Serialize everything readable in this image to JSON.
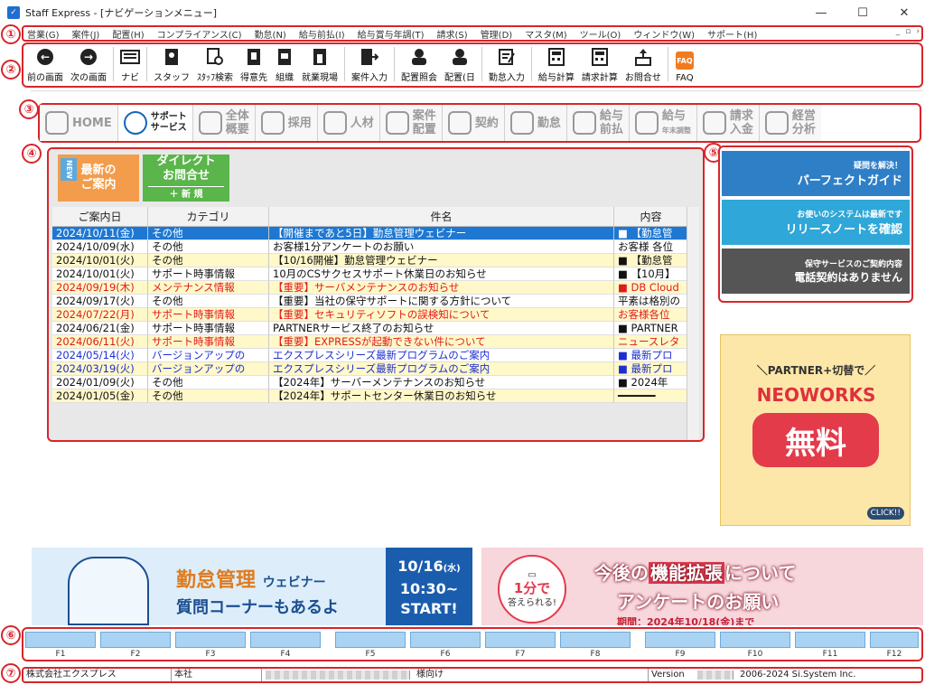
{
  "window": {
    "title": "Staff Express - [ナビゲーションメニュー]",
    "minimize": "—",
    "maximize": "☐",
    "close": "✕"
  },
  "menu": [
    "営業(G)",
    "案件(J)",
    "配置(H)",
    "コンプライアンス(C)",
    "勤怠(N)",
    "給与前払(I)",
    "給与賞与年調(T)",
    "請求(S)",
    "管理(D)",
    "マスタ(M)",
    "ツール(O)",
    "ウィンドウ(W)",
    "サポート(H)"
  ],
  "toolbar": {
    "items": [
      {
        "label": "前の画面",
        "icon": "back-arrow-icon"
      },
      {
        "label": "次の画面",
        "icon": "forward-arrow-icon"
      },
      {
        "label": "ナビ",
        "icon": "navi-keyboard-icon"
      },
      {
        "label": "スタッフ",
        "icon": "staff-book-icon"
      },
      {
        "label": "ｽﾀｯﾌ検索",
        "icon": "staff-search-icon"
      },
      {
        "label": "得意先",
        "icon": "customer-book-icon"
      },
      {
        "label": "組織",
        "icon": "organization-book-icon"
      },
      {
        "label": "就業現場",
        "icon": "worksite-book-icon"
      },
      {
        "label": "案件入力",
        "icon": "job-entry-icon"
      },
      {
        "label": "配置照会",
        "icon": "placement-inquiry-icon"
      },
      {
        "label": "配置(日",
        "icon": "placement-daily-icon"
      },
      {
        "label": "勤怠入力",
        "icon": "attendance-entry-icon"
      },
      {
        "label": "給与計算",
        "icon": "payroll-calc-icon"
      },
      {
        "label": "請求計算",
        "icon": "billing-calc-icon"
      },
      {
        "label": "お問合せ",
        "icon": "inquiry-icon"
      },
      {
        "label": "FAQ",
        "icon": "faq-icon"
      }
    ]
  },
  "tabs": [
    {
      "label": "HOME",
      "active": false
    },
    {
      "label": "サポート",
      "label2": "サービス",
      "active": true
    },
    {
      "label": "全体",
      "label2": "概要",
      "active": false
    },
    {
      "label": "採用",
      "active": false
    },
    {
      "label": "人材",
      "active": false
    },
    {
      "label": "案件",
      "label2": "配置",
      "active": false
    },
    {
      "label": "契約",
      "active": false
    },
    {
      "label": "勤怠",
      "active": false
    },
    {
      "label": "給与",
      "label2": "前払",
      "active": false
    },
    {
      "label": "給与",
      "label2": "年末調整",
      "active": false
    },
    {
      "label": "請求",
      "label2": "入金",
      "active": false
    },
    {
      "label": "経営",
      "label2": "分析",
      "active": false
    }
  ],
  "news": {
    "new_tag": "NEW",
    "latest_line1": "最新の",
    "latest_line2": "ご案内",
    "direct_line1": "ダイレクト",
    "direct_line2": "お問合せ",
    "direct_new": "＋ 新 規",
    "columns": [
      "ご案内日",
      "カテゴリ",
      "件名",
      "内容"
    ],
    "rows": [
      {
        "date": "2024/10/11(金)",
        "cat": "その他",
        "subject": "【開催まであと5日】勤怠管理ウェビナー",
        "content": "■ 【勤怠管",
        "style": "selected"
      },
      {
        "date": "2024/10/09(水)",
        "cat": "その他",
        "subject": "お客様1分アンケートのお願い",
        "content": "お客様 各位",
        "style": "white"
      },
      {
        "date": "2024/10/01(火)",
        "cat": "その他",
        "subject": "【10/16開催】勤怠管理ウェビナー",
        "content": "■ 【勤怠管",
        "style": "yellow"
      },
      {
        "date": "2024/10/01(火)",
        "cat": "サポート時事情報",
        "subject": "10月のCSサクセスサポート休業日のお知らせ",
        "content": "■ 【10月】",
        "style": "white"
      },
      {
        "date": "2024/09/19(木)",
        "cat": "メンテナンス情報",
        "subject": "【重要】サーバメンテナンスのお知らせ",
        "content": "■ DB Cloud",
        "style": "yellow-red"
      },
      {
        "date": "2024/09/17(火)",
        "cat": "その他",
        "subject": "【重要】当社の保守サポートに関する方針について",
        "content": "平素は格別の",
        "style": "white"
      },
      {
        "date": "2024/07/22(月)",
        "cat": "サポート時事情報",
        "subject": "【重要】セキュリティソフトの誤検知について",
        "content": "お客様各位",
        "style": "yellow-red"
      },
      {
        "date": "2024/06/21(金)",
        "cat": "サポート時事情報",
        "subject": "PARTNERサービス終了のお知らせ",
        "content": "■ PARTNER",
        "style": "white"
      },
      {
        "date": "2024/06/11(火)",
        "cat": "サポート時事情報",
        "subject": "【重要】EXPRESSが起動できない件について",
        "content": "ニュースレタ",
        "style": "yellow-red"
      },
      {
        "date": "2024/05/14(火)",
        "cat": "バージョンアップの",
        "subject": "エクスプレスシリーズ最新プログラムのご案内",
        "content": "■ 最新プロ",
        "style": "white-blue"
      },
      {
        "date": "2024/03/19(火)",
        "cat": "バージョンアップの",
        "subject": "エクスプレスシリーズ最新プログラムのご案内",
        "content": "■ 最新プロ",
        "style": "yellow-blue"
      },
      {
        "date": "2024/01/09(火)",
        "cat": "その他",
        "subject": "【2024年】サーバーメンテナンスのお知らせ",
        "content": "■ 2024年",
        "style": "white"
      },
      {
        "date": "2024/01/05(金)",
        "cat": "その他",
        "subject": "【2024年】サポートセンター休業日のお知らせ",
        "content": "━━━━━━",
        "style": "yellow"
      }
    ]
  },
  "side_links": {
    "guide_small": "疑問を解決！",
    "guide_main": "パーフェクトガイド",
    "release_small": "お使いのシステムは最新です",
    "release_main": "リリースノートを確認",
    "contract_line1": "保守サービスのご契約内容",
    "contract_line2": "電話契約はありません"
  },
  "banners": {
    "neo_top": "＼PARTNER+切替で／",
    "neo_name": "NEOWORKS",
    "neo_free": "無料",
    "neo_click": "CLICK!!",
    "webinar_title": "勤怠管理",
    "webinar_web": "ウェビナー",
    "webinar_sub": "質問コーナーもあるよ",
    "webinar_date": "10/16",
    "webinar_dow": "(水)",
    "webinar_time": "10:30~",
    "webinar_start": "START!",
    "survey_one": "1分で",
    "survey_answer": "答えられる!",
    "survey_title_pre": "今後の",
    "survey_title_hl": "機能拡張",
    "survey_title_post": "について",
    "survey_sub": "アンケートのお願い",
    "survey_period": "期間：2024年10/18(金)まで"
  },
  "fkeys": [
    "F1",
    "F2",
    "F3",
    "F4",
    "F5",
    "F6",
    "F7",
    "F8",
    "F9",
    "F10",
    "F11",
    "F12"
  ],
  "status": {
    "company": "株式会社エクスプレス",
    "branch": "本社",
    "user_suffix": "様向け",
    "version": "Version",
    "copyright": "2006-2024 Si.System Inc."
  },
  "markers": [
    "①",
    "②",
    "③",
    "④",
    "⑤",
    "⑥",
    "⑦"
  ],
  "colors": {
    "annotation": "#d8252b",
    "selected_row": "#1e78d2",
    "row_yellow": "#fff8c8",
    "text_red": "#e01b1b",
    "text_blue": "#1d2fd0"
  }
}
